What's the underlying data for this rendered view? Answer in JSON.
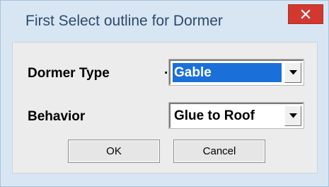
{
  "window": {
    "title": "First Select outline for Dormer",
    "close_icon": "close-icon",
    "close_color": "#d2382f",
    "titlebar_color": "#d8e6f3"
  },
  "form": {
    "dormer_type": {
      "label": "Dormer Type",
      "separator": ".",
      "value": "Gable",
      "highlight_color": "#1b6fd9"
    },
    "behavior": {
      "label": "Behavior",
      "value": "Glue to Roof"
    }
  },
  "buttons": {
    "ok_label": "OK",
    "cancel_label": "Cancel"
  }
}
